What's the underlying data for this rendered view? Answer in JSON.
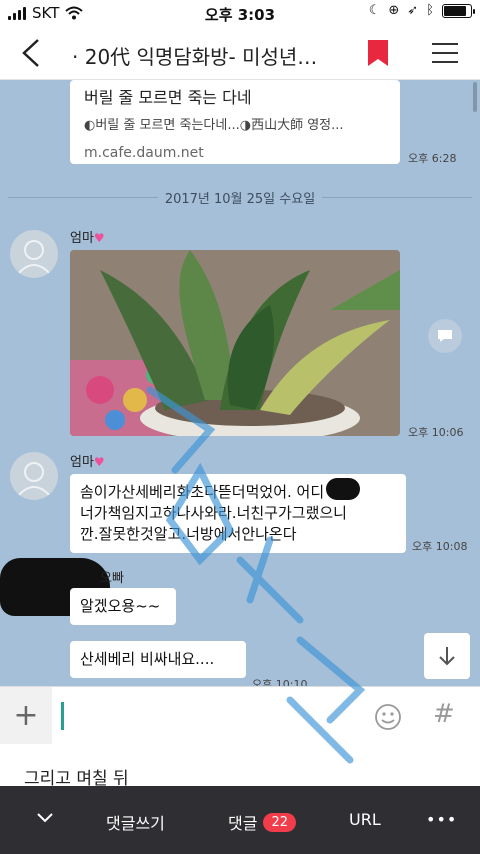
{
  "status_bar": {
    "carrier": "SKT",
    "time": "오후 3:03"
  },
  "nav": {
    "title": "· 20代 익명담화방- 미성년…"
  },
  "chat": {
    "link_card": {
      "title": "버릴 줄 모르면 죽는 다네",
      "description": "◐버릴 줄 모르면 죽는다네...◑西山大師 영정...",
      "url": "m.cafe.daum.net",
      "time": "오후 6:28"
    },
    "date_divider": "2017년 10월 25일 수요일",
    "messages": [
      {
        "sender": "엄마",
        "type": "photo",
        "time": "오후 10:06"
      },
      {
        "sender": "엄마",
        "lines": [
          "솜이가산세베리화초다뜯더먹었어.        어디",
          "너가책임지고하나사와라.너친구가그랬으니",
          "깐.잘못한것알고.너방에서안나온다"
        ],
        "time": "오후 10:08"
      },
      {
        "sender": "오빠",
        "text": "알겠오용~~"
      },
      {
        "text": "산세베리 비싸내요....",
        "time": "오후 10:10"
      }
    ]
  },
  "caption": "그리고 며칠 뒤",
  "bottom_bar": {
    "write_comment": "댓글쓰기",
    "comments_label": "댓글",
    "comment_count": "22",
    "url_label": "URL",
    "more": "•••"
  },
  "colors": {
    "chat_bg": "#a6bfd8",
    "accent_red": "#f03c4b",
    "heart": "#f04f9b",
    "bottom_bar": "#2f2f33"
  }
}
